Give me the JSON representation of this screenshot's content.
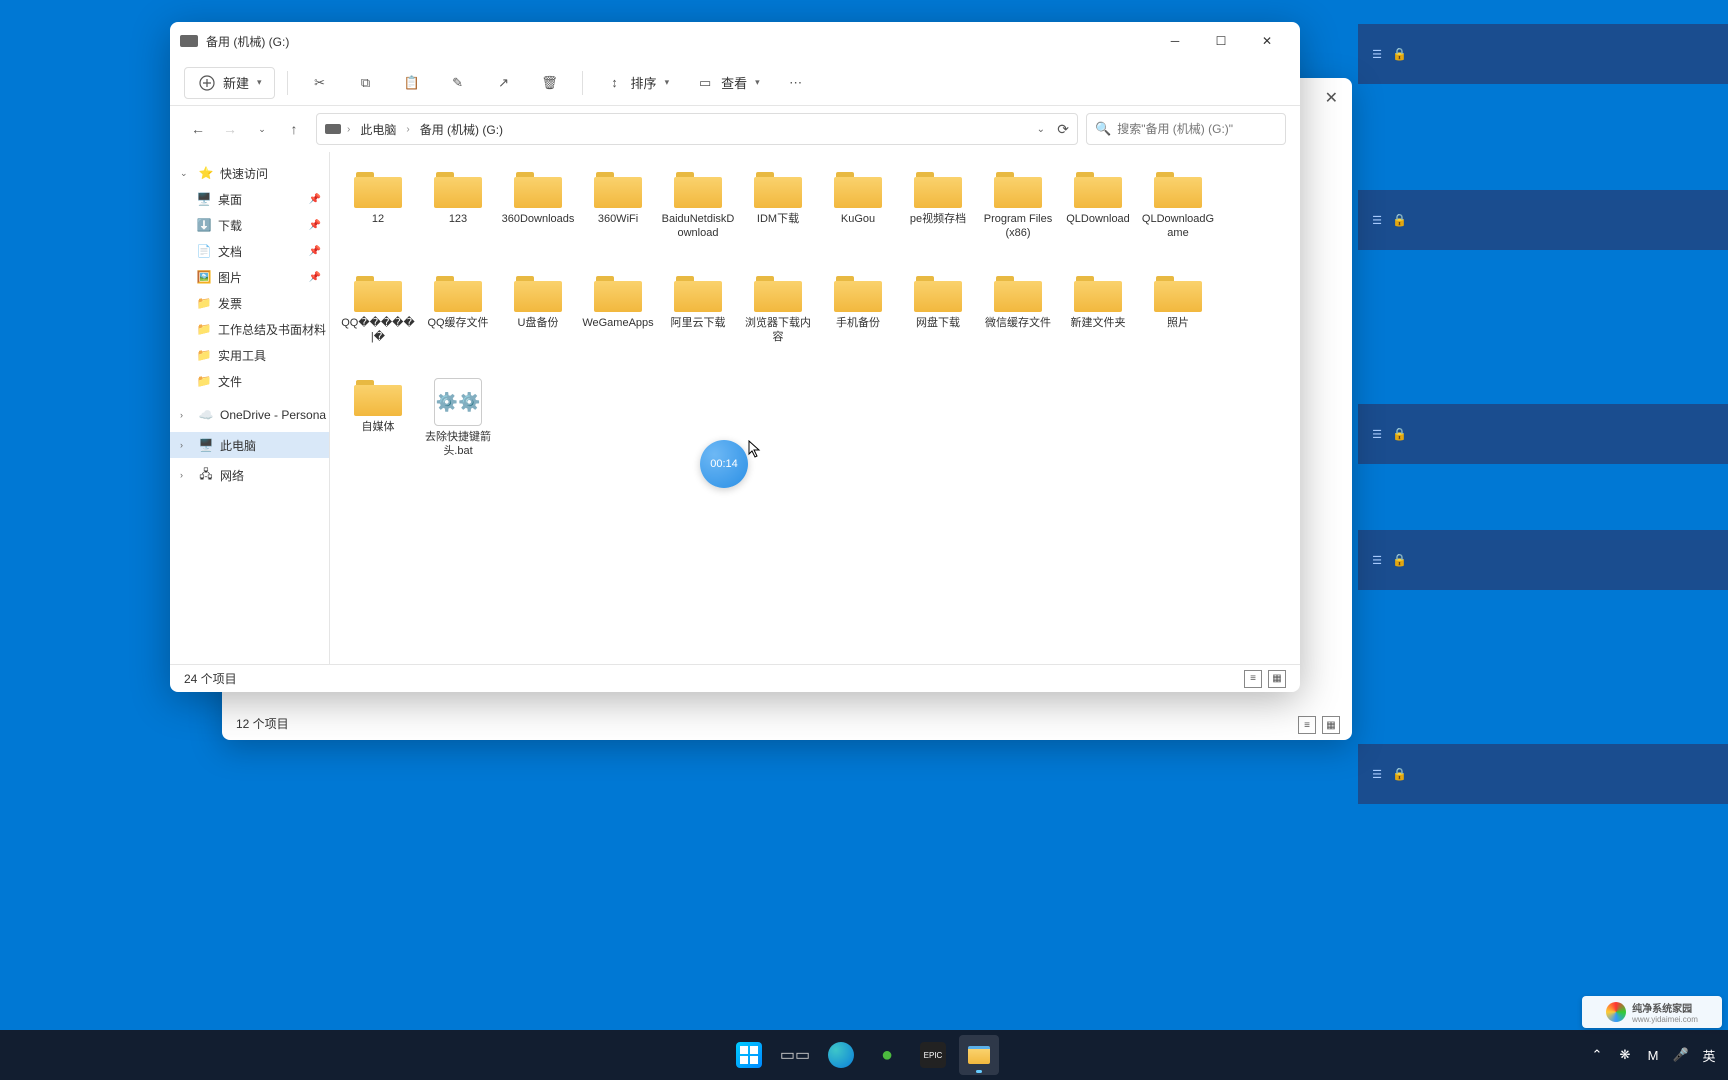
{
  "window": {
    "title": "备用 (机械)  (G:)",
    "breadcrumbs": [
      "此电脑",
      "备用 (机械)  (G:)"
    ],
    "search_placeholder": "搜索\"备用 (机械) (G:)\"",
    "status": "24 个项目"
  },
  "window_bg": {
    "status": "12 个项目"
  },
  "toolbar": {
    "new_label": "新建",
    "sort_label": "排序",
    "view_label": "查看"
  },
  "sidebar": {
    "quick_access": "快速访问",
    "items": [
      {
        "label": "桌面",
        "icon": "desktop",
        "pinned": true
      },
      {
        "label": "下载",
        "icon": "download",
        "pinned": true
      },
      {
        "label": "文档",
        "icon": "document",
        "pinned": true
      },
      {
        "label": "图片",
        "icon": "picture",
        "pinned": true
      },
      {
        "label": "发票",
        "icon": "folder",
        "pinned": false
      },
      {
        "label": "工作总结及书面材料",
        "icon": "folder",
        "pinned": false
      },
      {
        "label": "实用工具",
        "icon": "folder",
        "pinned": false
      },
      {
        "label": "文件",
        "icon": "folder",
        "pinned": false
      }
    ],
    "onedrive": "OneDrive - Persona",
    "this_pc": "此电脑",
    "network": "网络"
  },
  "folders": [
    {
      "name": "12",
      "type": "folder"
    },
    {
      "name": "123",
      "type": "folder"
    },
    {
      "name": "360Downloads",
      "type": "folder"
    },
    {
      "name": "360WiFi",
      "type": "folder"
    },
    {
      "name": "BaiduNetdiskDownload",
      "type": "folder"
    },
    {
      "name": "IDM下载",
      "type": "folder"
    },
    {
      "name": "KuGou",
      "type": "folder"
    },
    {
      "name": "pe视频存档",
      "type": "folder"
    },
    {
      "name": "Program Files (x86)",
      "type": "folder"
    },
    {
      "name": "QLDownload",
      "type": "folder"
    },
    {
      "name": "QLDownloadGame",
      "type": "folder"
    },
    {
      "name": "QQ�����|�",
      "type": "folder"
    },
    {
      "name": "QQ缓存文件",
      "type": "folder"
    },
    {
      "name": "U盘备份",
      "type": "folder"
    },
    {
      "name": "WeGameApps",
      "type": "folder"
    },
    {
      "name": "阿里云下载",
      "type": "folder"
    },
    {
      "name": "浏览器下载内容",
      "type": "folder"
    },
    {
      "name": "手机备份",
      "type": "folder"
    },
    {
      "name": "网盘下载",
      "type": "folder"
    },
    {
      "name": "微信缓存文件",
      "type": "folder"
    },
    {
      "name": "新建文件夹",
      "type": "folder"
    },
    {
      "name": "照片",
      "type": "folder"
    },
    {
      "name": "自媒体",
      "type": "folder"
    },
    {
      "name": "去除快捷键箭头.bat",
      "type": "bat"
    }
  ],
  "timer": "00:14",
  "taskbar": {
    "ime": "英",
    "tray_label": "M"
  },
  "watermark": {
    "brand": "纯净系统家园",
    "url": "www.yidaimei.com"
  }
}
